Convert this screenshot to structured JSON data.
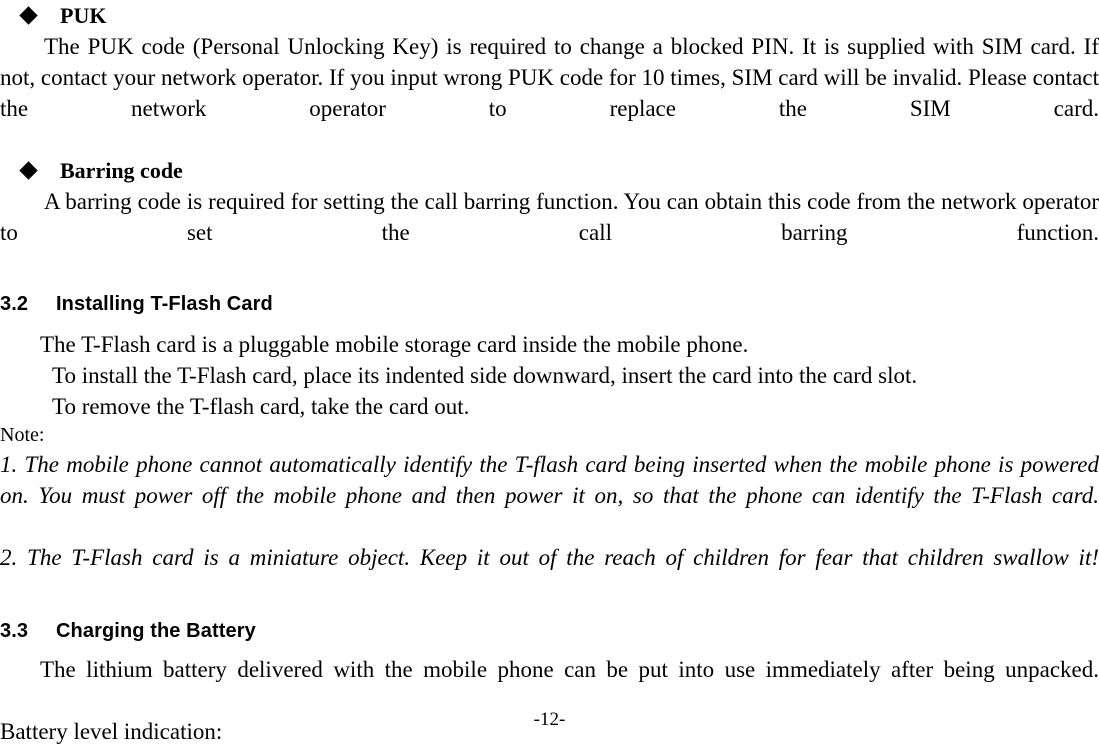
{
  "page": {
    "footer_page_number": "-12-"
  },
  "blocks": {
    "puk": {
      "heading": "PUK",
      "bullet_glyph": "diamond",
      "paragraph": "The PUK code (Personal Unlocking Key) is required to change a blocked PIN. It is supplied with SIM card. If not, contact your network operator. If you input wrong PUK code for 10 times, SIM card will be invalid. Please contact the network operator to replace the SIM card."
    },
    "barring": {
      "heading": "Barring code",
      "bullet_glyph": "diamond",
      "paragraph": "A barring code is required for setting the call barring function. You can obtain this code from the network operator to set the call barring function."
    },
    "section_3_2": {
      "number": "3.2",
      "title": "Installing T-Flash Card",
      "intro": "The T-Flash card is a pluggable mobile storage card inside the mobile phone.",
      "step_install": "To install the T-Flash card, place its indented side downward, insert the card into the card slot.",
      "step_remove": "To remove the T-flash card, take the card out.",
      "note_label": "Note:",
      "notes": [
        "1. The mobile phone cannot automatically identify the T-flash card being inserted when the mobile phone is powered on. You must power off the mobile phone and then power it on, so that the phone can identify the T-Flash card.",
        "2. The T-Flash card is a miniature object. Keep it out of the reach of children for fear that children swallow it!"
      ]
    },
    "section_3_3": {
      "number": "3.3",
      "title": "Charging the Battery",
      "paragraph": "The lithium battery delivered with the mobile phone can be put into use immediately after being unpacked.",
      "battery_level_label": "Battery level indication:"
    }
  }
}
